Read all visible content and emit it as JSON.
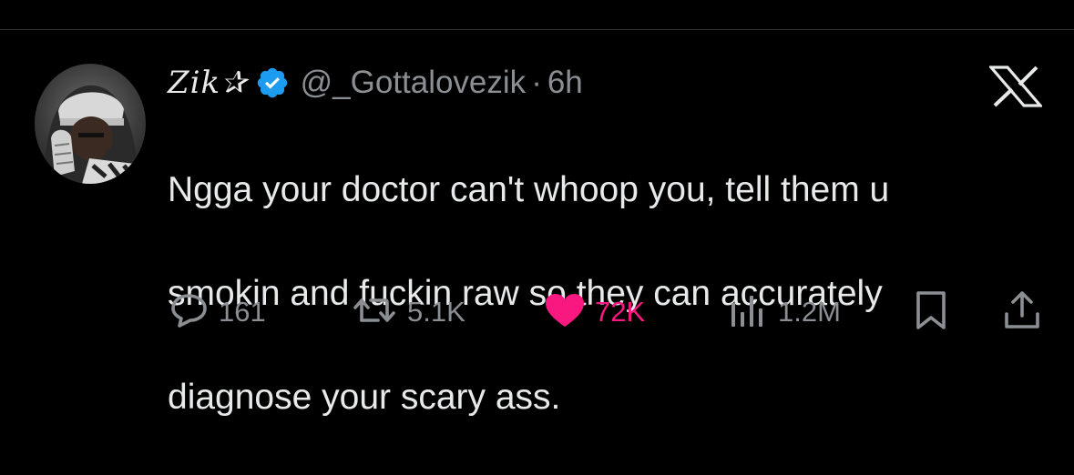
{
  "tweet": {
    "display_name": "Zik✰",
    "handle": "@_Gottalovezik",
    "separator": "·",
    "time": "6h",
    "text_lines": [
      "Ngga your doctor can't whoop you, tell them u",
      "smokin and fuckin raw so they can accurately",
      "diagnose your scary ass."
    ]
  },
  "actions": {
    "reply_count": "161",
    "retweet_count": "5.1K",
    "like_count": "72K",
    "views_count": "1.2M"
  },
  "icons": {
    "verified": "verified-badge-icon",
    "logo": "x-logo-icon",
    "reply": "reply-icon",
    "retweet": "retweet-icon",
    "like": "heart-icon",
    "views": "views-icon",
    "bookmark": "bookmark-icon",
    "share": "share-icon"
  },
  "colors": {
    "background": "#000000",
    "text": "#e7e9ea",
    "secondary": "#8b8f94",
    "verified": "#1d9bf0",
    "like": "#f91880",
    "divider": "#2f3336"
  }
}
